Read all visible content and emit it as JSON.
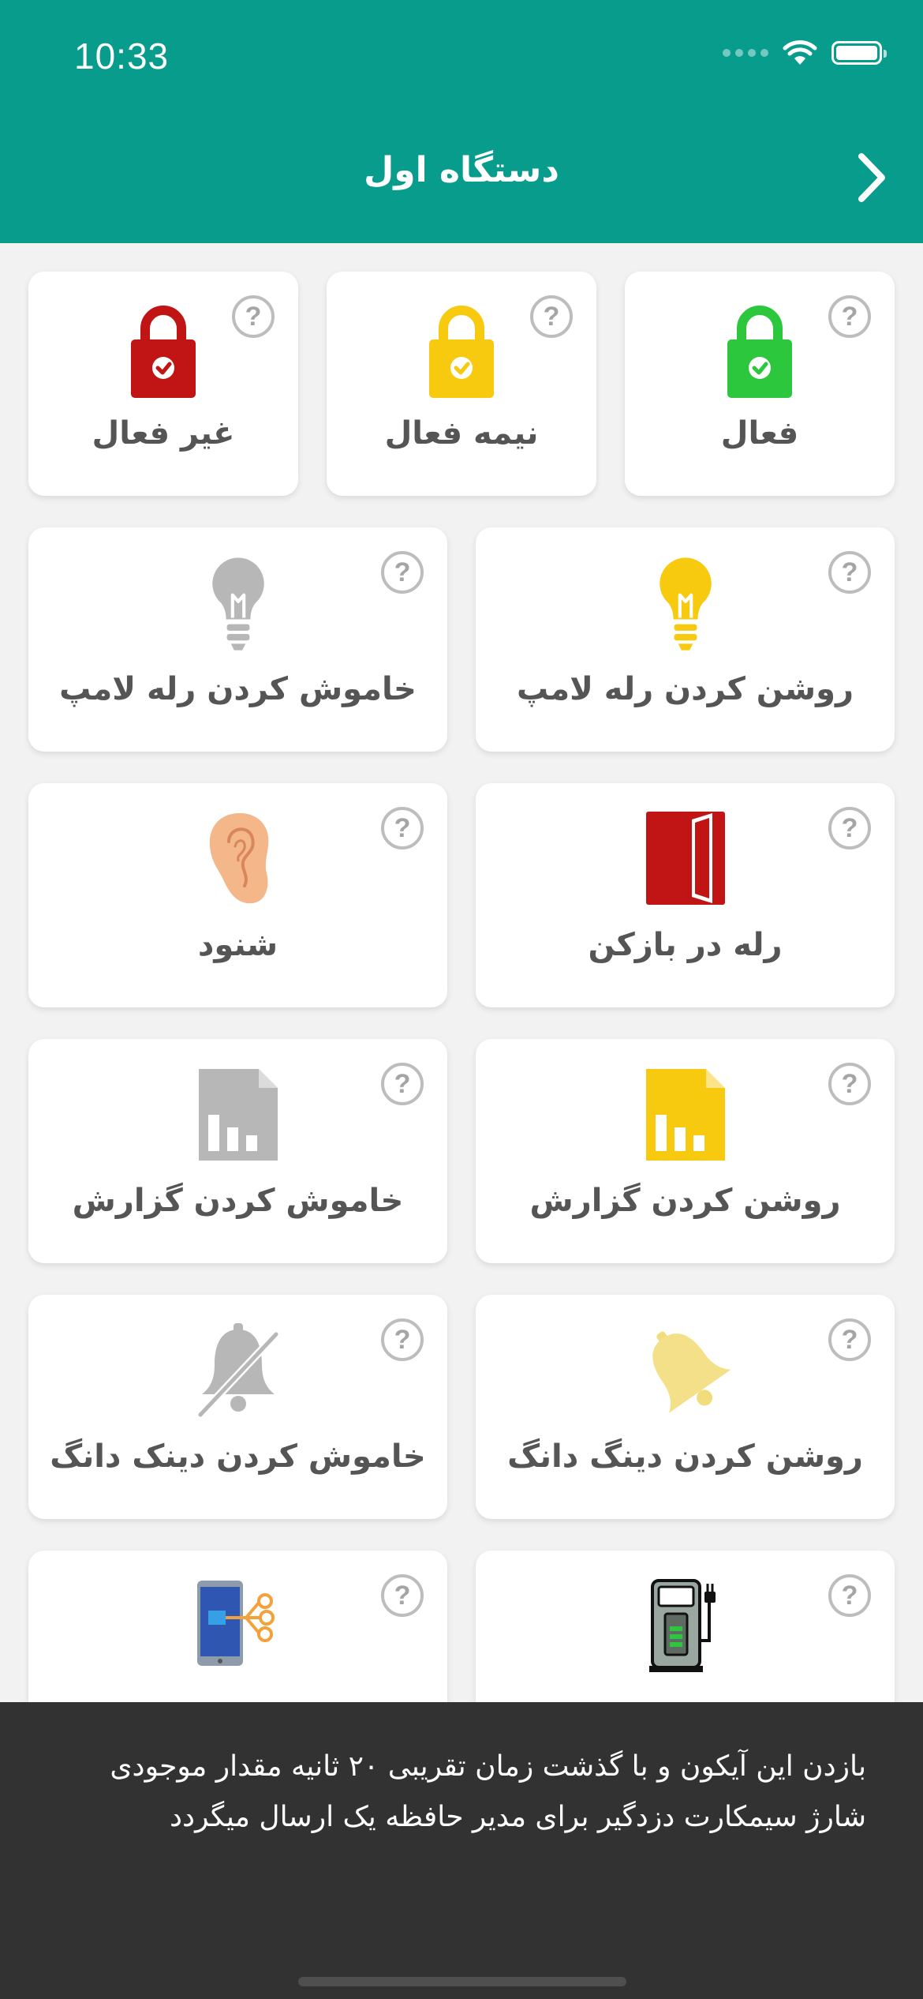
{
  "status": {
    "time": "10:33"
  },
  "header": {
    "title": "دستگاه اول"
  },
  "help_glyph": "?",
  "cards": [
    {
      "label": "فعال",
      "icon": "lock-green-icon"
    },
    {
      "label": "نیمه فعال",
      "icon": "lock-yellow-icon"
    },
    {
      "label": "غیر فعال",
      "icon": "lock-red-icon"
    },
    {
      "label": "روشن کردن رله لامپ",
      "icon": "bulb-on-icon"
    },
    {
      "label": "خاموش کردن رله لامپ",
      "icon": "bulb-off-icon"
    },
    {
      "label": "رله در بازکن",
      "icon": "door-icon"
    },
    {
      "label": "شنود",
      "icon": "ear-icon"
    },
    {
      "label": "روشن کردن گزارش",
      "icon": "report-on-icon"
    },
    {
      "label": "خاموش کردن گزارش",
      "icon": "report-off-icon"
    },
    {
      "label": "روشن کردن دینگ دانگ",
      "icon": "bell-on-icon"
    },
    {
      "label": "خاموش کردن دینک دانگ",
      "icon": "bell-off-icon"
    },
    {
      "label": "",
      "icon": "charging-station-icon"
    },
    {
      "label": "",
      "icon": "phone-network-icon"
    }
  ],
  "toast": {
    "text": "بازدن این آیکون و با گذشت زمان تقریبی ۲۰ ثانیه مقدار موجودی شارژ سیمکارت دزدگیر برای مدیر حافظه یک ارسال میگردد"
  },
  "colors": {
    "header": "#079c8c",
    "green": "#2cc73d",
    "yellow": "#f7ca10",
    "red": "#c11414",
    "gray": "#b7b7b7"
  }
}
